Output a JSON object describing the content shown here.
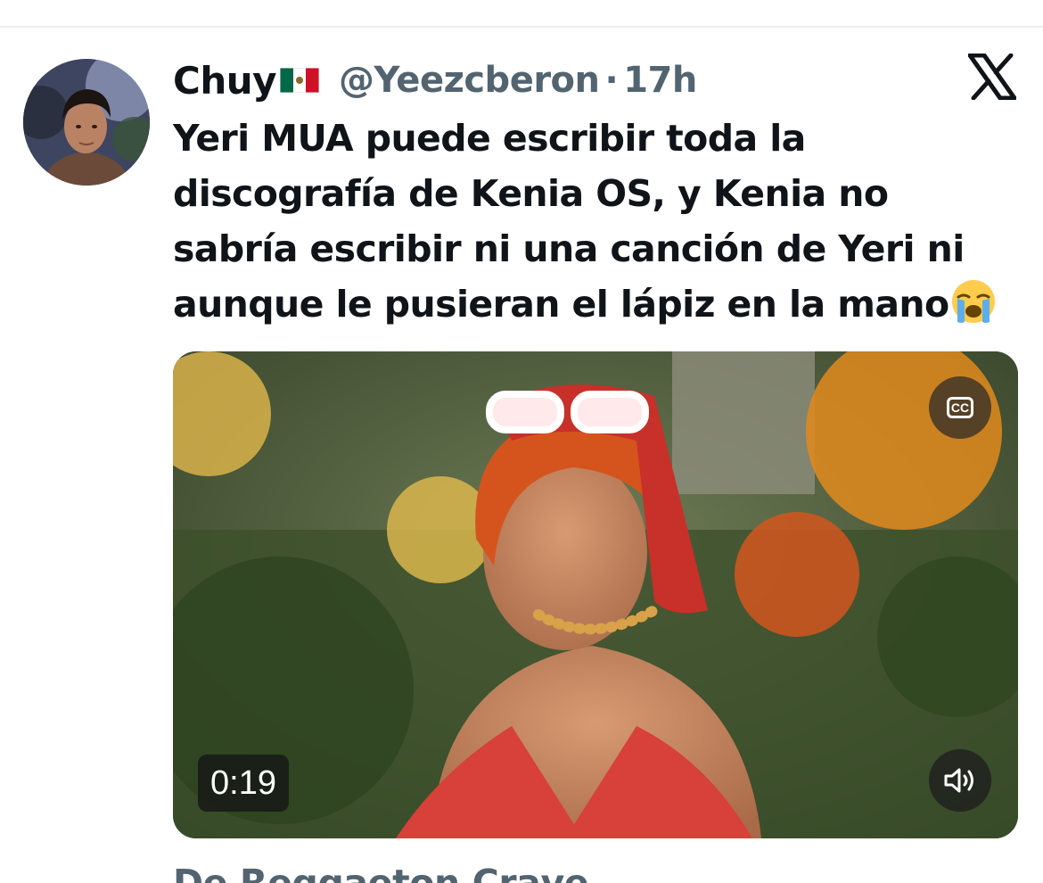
{
  "tweet": {
    "display_name": "Chuy",
    "flag_icon": "mexico-flag-icon",
    "handle": "@Yeezcberon",
    "separator": "·",
    "time": "17h",
    "text_lines": [
      "Yeri MUA puede escribir toda la",
      "discografía de Kenia OS, y Kenia no",
      "sabría escribir ni una canción de Yeri ni",
      "aunque le pusieran el lápiz en la mano"
    ],
    "emoji_icon": "loudly-crying-face-icon"
  },
  "media": {
    "duration": "0:19",
    "captions_label": "CC"
  },
  "quoted": {
    "label": "De Reggaeton Crave"
  },
  "colors": {
    "text": "#0f1419",
    "secondary": "#536471",
    "background": "#ffffff"
  }
}
